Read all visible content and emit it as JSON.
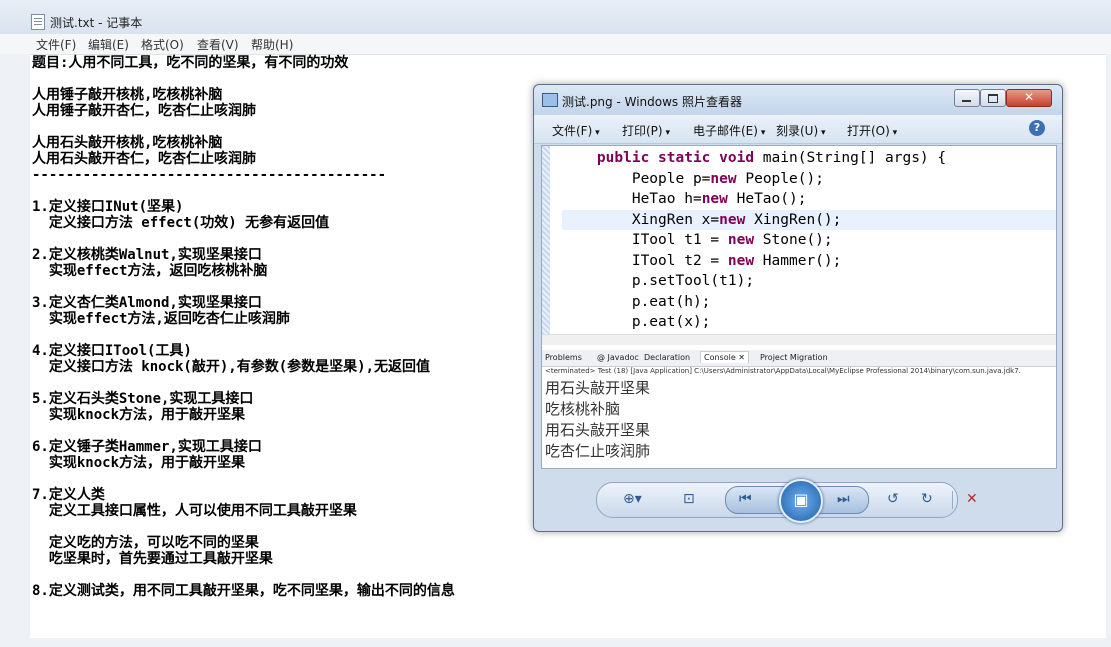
{
  "notepad": {
    "title": "测试.txt - 记事本",
    "menu": [
      "文件(F)",
      "编辑(E)",
      "格式(O)",
      "查看(V)",
      "帮助(H)"
    ],
    "lines": [
      "题目:人用不同工具，吃不同的坚果，有不同的功效",
      "",
      "人用锤子敲开核桃,吃核桃补脑",
      "人用锤子敲开杏仁，吃杏仁止咳润肺",
      "",
      "人用石头敲开核桃,吃核桃补脑",
      "人用石头敲开杏仁，吃杏仁止咳润肺",
      "------------------------------------------",
      "",
      "1.定义接口INut(坚果)",
      "  定义接口方法 effect(功效) 无参有返回值",
      "",
      "2.定义核桃类Walnut,实现坚果接口",
      "  实现effect方法，返回吃核桃补脑",
      "",
      "3.定义杏仁类Almond,实现坚果接口",
      "  实现effect方法,返回吃杏仁止咳润肺",
      "",
      "4.定义接口ITool(工具)",
      "  定义接口方法 knock(敲开),有参数(参数是坚果),无返回值",
      "",
      "5.定义石头类Stone,实现工具接口",
      "  实现knock方法，用于敲开坚果",
      "",
      "6.定义锤子类Hammer,实现工具接口",
      "  实现knock方法，用于敲开坚果",
      "",
      "7.定义人类",
      "  定义工具接口属性，人可以使用不同工具敲开坚果",
      "",
      "  定义吃的方法，可以吃不同的坚果",
      "  吃坚果时，首先要通过工具敲开坚果",
      "",
      "8.定义测试类，用不同工具敲开坚果，吃不同坚果，输出不同的信息"
    ]
  },
  "viewer": {
    "title": "测试.png - Windows 照片查看器",
    "toolbar": [
      "文件(F)",
      "打印(P)",
      "电子邮件(E)",
      "刻录(U)",
      "打开(O)"
    ],
    "help": "?",
    "close": "✕",
    "code": {
      "sig_kw": "public static void",
      "sig_rest": " main(String[] args) {",
      "l1a": "People p=",
      "l1k": "new",
      "l1b": " People();",
      "l2a": "HeTao h=",
      "l2k": "new",
      "l2b": " HeTao();",
      "l3a": "XingRen x=",
      "l3k": "new",
      "l3b": " XingRen();",
      "l4a": "ITool t1 = ",
      "l4k": "new",
      "l4b": " Stone();",
      "l5a": "ITool t2 = ",
      "l5k": "new",
      "l5b": " Hammer();",
      "l6": "p.setTool(t1);",
      "l7": "p.eat(h);",
      "l8": "p.eat(x);"
    },
    "tabs": [
      "Problems",
      "@ Javadoc",
      "Declaration",
      "Console ✕",
      "Project Migration"
    ],
    "terminated": "<terminated> Test (18) [Java Application] C:\\Users\\Administrator\\AppData\\Local\\MyEclipse Professional 2014\\binary\\com.sun.java.jdk7.",
    "console": [
      "用石头敲开坚果",
      "吃核桃补脑",
      "用石头敲开坚果",
      "吃杏仁止咳润肺"
    ],
    "controls": {
      "zoom": "⊕▾",
      "fit": "⊡",
      "prev": "⏮",
      "slideshow": "▣",
      "next": "⏭",
      "rotate_ccw": "↺",
      "rotate_cw": "↻",
      "delete": "✕"
    }
  }
}
